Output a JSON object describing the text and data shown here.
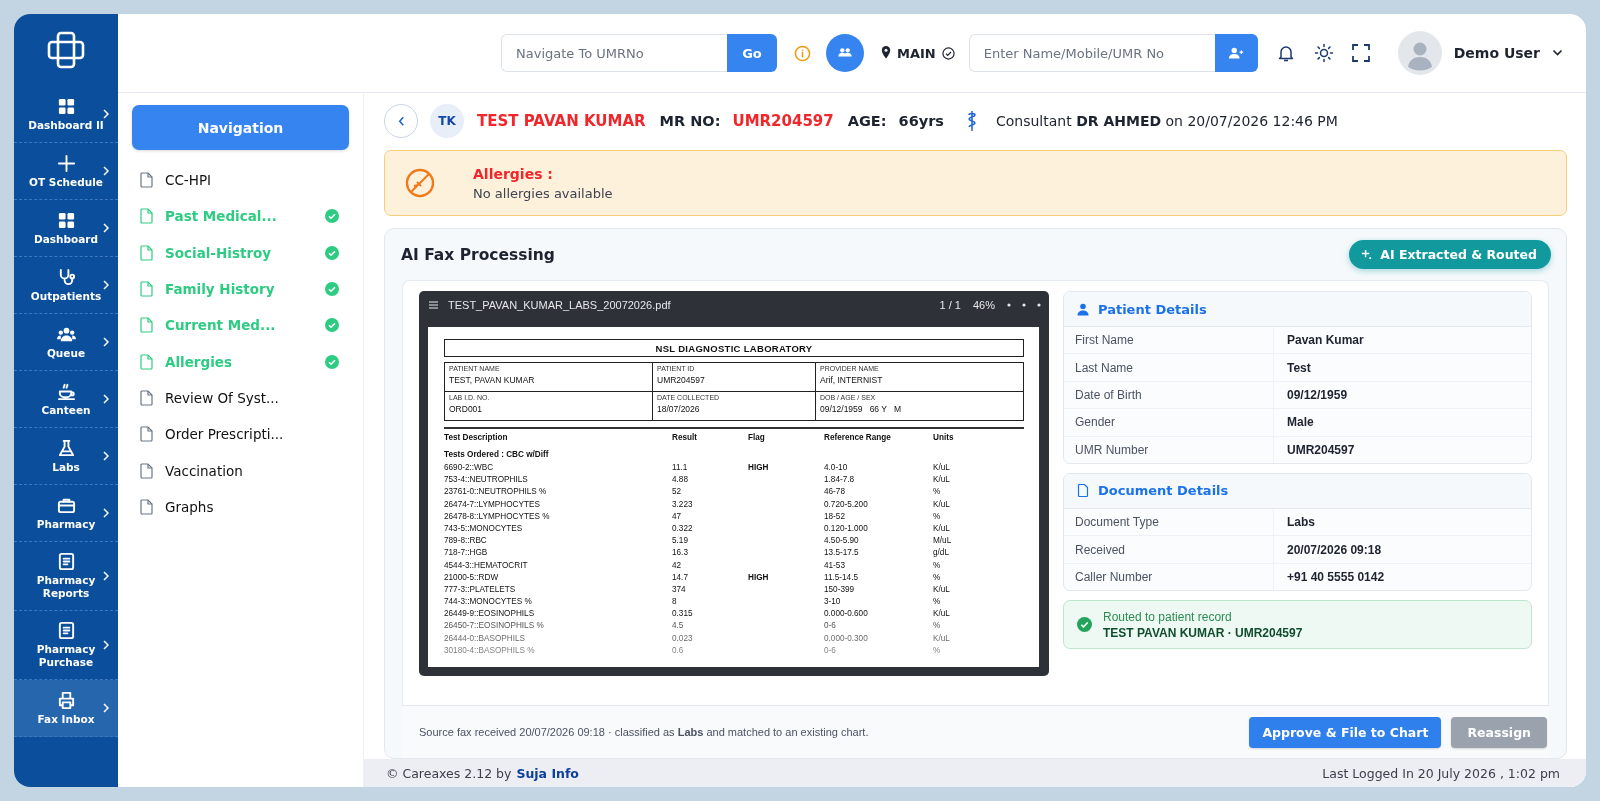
{
  "sidebar": {
    "items": [
      {
        "label": "Dashboard II",
        "selected": false
      },
      {
        "label": "OT Schedule",
        "selected": false
      },
      {
        "label": "Dashboard",
        "selected": false
      },
      {
        "label": "Outpatients",
        "selected": false
      },
      {
        "label": "Queue",
        "selected": false
      },
      {
        "label": "Canteen",
        "selected": false
      },
      {
        "label": "Labs",
        "selected": false
      },
      {
        "label": "Pharmacy",
        "selected": false
      },
      {
        "label": "Pharmacy Reports",
        "selected": false
      },
      {
        "label": "Pharmacy Purchase",
        "selected": false
      },
      {
        "label": "Fax Inbox",
        "selected": true
      }
    ]
  },
  "header": {
    "umr_search": {
      "placeholder": "Navigate To UMRNo",
      "button": "Go"
    },
    "location": "MAIN",
    "patient_search": {
      "placeholder": "Enter Name/Mobile/UMR No"
    },
    "user": "Demo User"
  },
  "navigation": {
    "title": "Navigation",
    "items": [
      {
        "label": "CC-HPI",
        "completed": false
      },
      {
        "label": "Past Medical...",
        "completed": true
      },
      {
        "label": "Social-Histroy",
        "completed": true
      },
      {
        "label": "Family History",
        "completed": true
      },
      {
        "label": "Current Med...",
        "completed": true
      },
      {
        "label": "Allergies",
        "completed": true
      },
      {
        "label": "Review Of Syst...",
        "completed": false
      },
      {
        "label": "Order Prescripti...",
        "completed": false
      },
      {
        "label": "Vaccination",
        "completed": false
      },
      {
        "label": "Graphs",
        "completed": false
      }
    ]
  },
  "patient": {
    "initials": "TK",
    "name": "TEST PAVAN KUMAR",
    "mr_label": "MR NO:",
    "mr_no": "UMR204597",
    "age_label": "AGE:",
    "age": "66yrs",
    "consultant": "Consultant **DR AHMED** on 20/07/2026 12:46 PM"
  },
  "allergies": {
    "title": "Allergies :",
    "text": "No allergies available"
  },
  "fax": {
    "title": "AI Fax Processing",
    "badge": "AI Extracted & Routed",
    "viewer": {
      "filename": "TEST_PAVAN_KUMAR_LABS_20072026.pdf",
      "page": "1 / 1",
      "zoom": "46%",
      "document": {
        "lab_name": "NSL DIAGNOSTIC LABORATORY",
        "fields": [
          {
            "label": "PATIENT NAME",
            "value": "TEST, PAVAN KUMAR"
          },
          {
            "label": "PATIENT ID",
            "value": "UMR204597"
          },
          {
            "label": "PROVIDER NAME",
            "value": "Arif, INTERNIST"
          },
          {
            "label": "LAB I.D. NO.",
            "value": "ORD001"
          },
          {
            "label": "DATE COLLECTED",
            "value": "18/07/2026"
          },
          {
            "label": "DOB / AGE / SEX",
            "value": "09/12/1959   66 Y   M"
          }
        ],
        "columns": [
          "Test Description",
          "Result",
          "Flag",
          "Reference Range",
          "Units"
        ],
        "section": "Tests Ordered : CBC w/Diff",
        "rows": [
          {
            "test": "6690-2::WBC",
            "result": "11.1",
            "flag": "HIGH",
            "range": "4.0-10",
            "units": "K/uL"
          },
          {
            "test": "753-4::NEUTROPHILS",
            "result": "4.88",
            "range": "1.84-7.8",
            "units": "K/uL"
          },
          {
            "test": "23761-0::NEUTROPHILS %",
            "result": "52",
            "range": "46-78",
            "units": "%"
          },
          {
            "test": "26474-7::LYMPHOCYTES",
            "result": "3.223",
            "range": "0.720-5.200",
            "units": "K/uL"
          },
          {
            "test": "26478-8::LYMPHOCYTES %",
            "result": "47",
            "range": "18-52",
            "units": "%"
          },
          {
            "test": "743-5::MONOCYTES",
            "result": "0.322",
            "range": "0.120-1.000",
            "units": "K/uL"
          },
          {
            "test": "789-8::RBC",
            "result": "5.19",
            "range": "4.50-5.90",
            "units": "M/uL"
          },
          {
            "test": "718-7::HGB",
            "result": "16.3",
            "range": "13.5-17.5",
            "units": "g/dL"
          },
          {
            "test": "4544-3::HEMATOCRIT",
            "result": "42",
            "range": "41-53",
            "units": "%"
          },
          {
            "test": "21000-5::RDW",
            "result": "14.7",
            "flag": "HIGH",
            "range": "11.5-14.5",
            "units": "%"
          },
          {
            "test": "777-3::PLATELETS",
            "result": "374",
            "range": "150-399",
            "units": "K/uL"
          },
          {
            "test": "744-3::MONOCYTES %",
            "result": "8",
            "range": "3-10",
            "units": "%"
          },
          {
            "test": "26449-9::EOSINOPHILS",
            "result": "0.315",
            "range": "0.000-0.600",
            "units": "K/uL"
          },
          {
            "test": "26450-7::EOSINOPHILS %",
            "result": "4.5",
            "range": "0-6",
            "units": "%"
          },
          {
            "test": "26444-0::BASOPHILS",
            "result": "0.023",
            "range": "0.000-0.300",
            "units": "K/uL"
          },
          {
            "test": "30180-4::BASOPHILS %",
            "result": "0.6",
            "range": "0-6",
            "units": "%"
          }
        ]
      }
    },
    "patient_details": {
      "title": "Patient Details",
      "rows": [
        {
          "label": "First Name",
          "value": "Pavan Kumar"
        },
        {
          "label": "Last Name",
          "value": "Test"
        },
        {
          "label": "Date of Birth",
          "value": "09/12/1959"
        },
        {
          "label": "Gender",
          "value": "Male"
        },
        {
          "label": "UMR Number",
          "value": "UMR204597"
        }
      ]
    },
    "document_details": {
      "title": "Document Details",
      "rows": [
        {
          "label": "Document Type",
          "value": "Labs"
        },
        {
          "label": "Received",
          "value": "20/07/2026 09:18"
        },
        {
          "label": "Caller Number",
          "value": "+91 40 5555 0142"
        }
      ]
    },
    "routed": {
      "title": "Routed to patient record",
      "detail": "TEST PAVAN KUMAR · UMR204597"
    },
    "footer_text": "Source fax received 20/07/2026 09:18 · classified as **Labs** and matched to an existing chart.",
    "buttons": [
      {
        "label": "Approve & File to Chart",
        "kind": "primary"
      },
      {
        "label": "Reassign",
        "kind": "secondary"
      }
    ]
  },
  "footer": {
    "copyright": "© Careaxes 2.12 by",
    "company": "Suja Info",
    "last_login": "Last Logged In 20 July 2026 , 1:02 pm"
  }
}
